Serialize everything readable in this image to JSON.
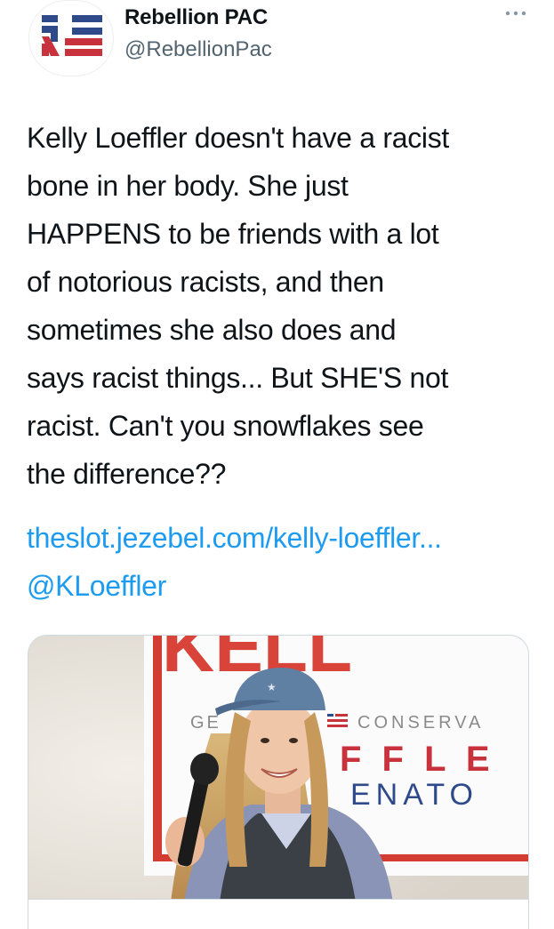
{
  "tweet": {
    "author": {
      "name": "Rebellion PAC",
      "handle": "@RebellionPac",
      "avatar_icon": "rebellion-pac-logo",
      "logo_colors": {
        "blue": "#2e4a8a",
        "red": "#c8323c"
      }
    },
    "more_icon": "ellipsis-icon",
    "text_lines": [
      "Kelly Loeffler doesn't have a racist",
      "bone in her body. She just",
      "HAPPENS to be friends with a lot",
      "of notorious racists, and then",
      "sometimes she also does and",
      "says racist things...  But SHE'S not",
      "racist. Can't you snowflakes see",
      "the difference??"
    ],
    "link": "theslot.jezebel.com/kelly-loeffler...",
    "mention": "@KLoeffler",
    "link_color": "#1d9bf0",
    "card": {
      "image_icon": "kelly-loeffler-photo",
      "sign_texts": {
        "top": "KELL",
        "left": "GE",
        "flag_line": "CONSERVA",
        "middle": "F F L E",
        "bottom": "ENATO"
      }
    }
  }
}
